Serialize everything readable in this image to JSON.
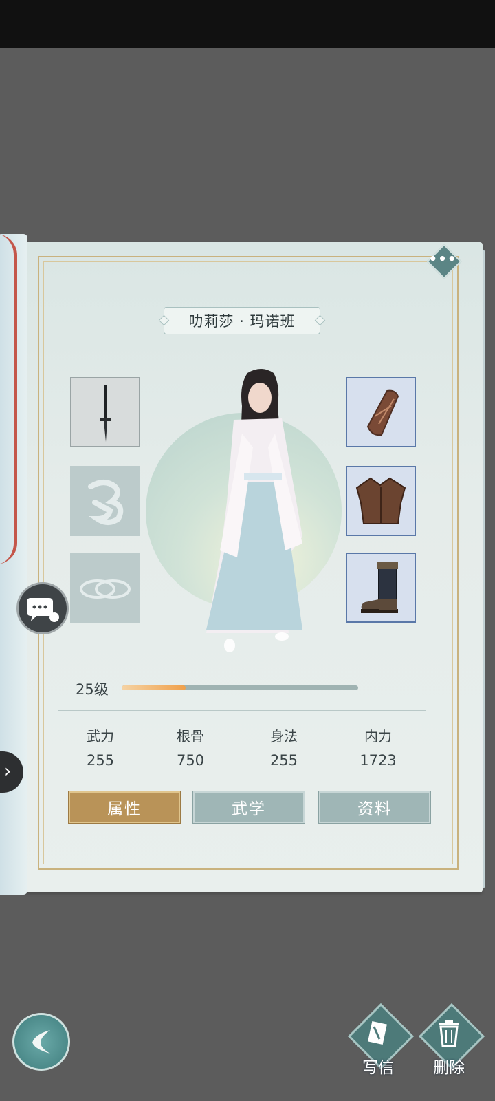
{
  "character": {
    "name": "叻莉莎 · 玛诺班"
  },
  "level": {
    "label": "25级",
    "progress": 0.27
  },
  "stats": [
    {
      "label": "武力",
      "value": "255"
    },
    {
      "label": "根骨",
      "value": "750"
    },
    {
      "label": "身法",
      "value": "255"
    },
    {
      "label": "内力",
      "value": "1723"
    }
  ],
  "tabs": [
    {
      "label": "属性",
      "active": true
    },
    {
      "label": "武学",
      "active": false
    },
    {
      "label": "资料",
      "active": false
    }
  ],
  "equipment": {
    "left": [
      "dagger-icon",
      "ornament-icon",
      "rings-icon"
    ],
    "right": [
      "bracer-icon",
      "chest-armor-icon",
      "boots-icon"
    ]
  },
  "bottom_actions": [
    {
      "label": "写信",
      "icon": "letter-icon"
    },
    {
      "label": "删除",
      "icon": "trash-icon"
    }
  ],
  "colors": {
    "accent_gold": "#b99358",
    "accent_teal": "#4d7a79",
    "level_fill": "#f0a04b"
  }
}
